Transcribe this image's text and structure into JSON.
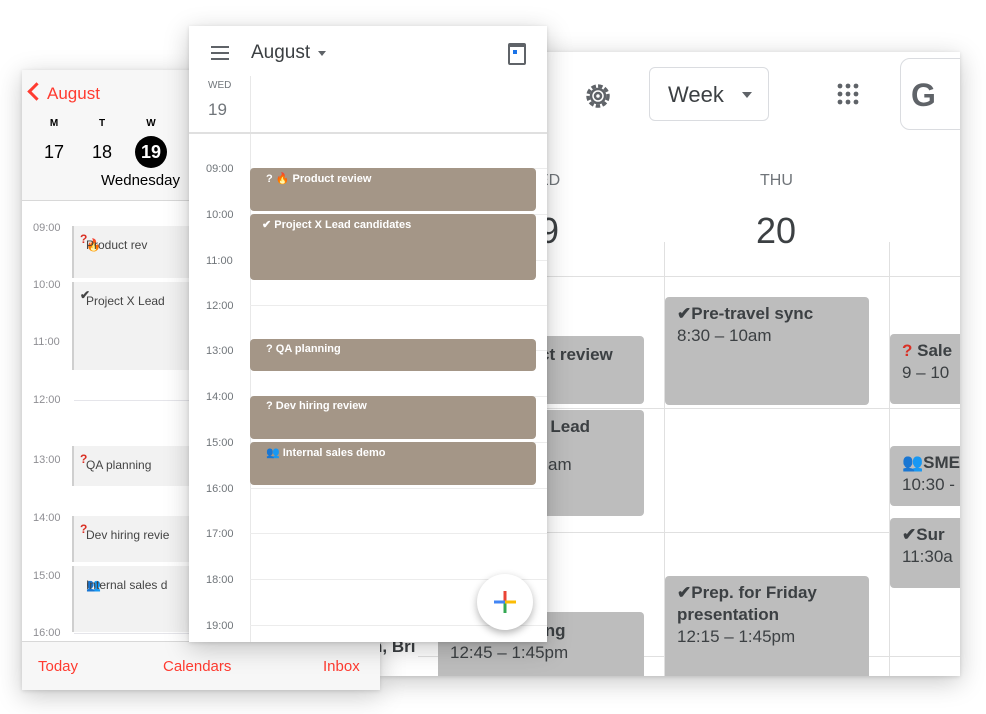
{
  "desktop": {
    "view_label": "Week",
    "search_partial": "G",
    "days": [
      {
        "name": "ED",
        "num": "9"
      },
      {
        "name": "THU",
        "num": "20"
      }
    ],
    "events": [
      {
        "title": "ct review",
        "time": ""
      },
      {
        "title": "( Lead",
        "time": "am"
      },
      {
        "title": "ing",
        "time": "12:45 – 1:45pm"
      },
      {
        "title": "n, Bri",
        "time": ""
      },
      {
        "title": "✔Pre-travel sync",
        "time": "8:30 – 10am"
      },
      {
        "title": "✔Prep. for Friday presentation",
        "time": "12:15 – 1:45pm"
      },
      {
        "title": "Sale",
        "time": "9 – 10"
      },
      {
        "title": "SME",
        "time": "10:30 -"
      },
      {
        "title": "✔Sur",
        "time": "11:30a"
      }
    ]
  },
  "ios": {
    "back_label": "August",
    "weekdays": [
      "M",
      "T",
      "W"
    ],
    "dates": [
      "17",
      "18",
      "19"
    ],
    "selected_date": "19",
    "day_title": "Wednesday",
    "times": [
      "09:00",
      "10:00",
      "11:00",
      "12:00",
      "13:00",
      "14:00",
      "15:00",
      "16:00"
    ],
    "events": [
      {
        "icon": "?",
        "icon2": "🔥",
        "title": "Product rev"
      },
      {
        "icon": "✔",
        "title": "Project X Lead"
      },
      {
        "icon": "?",
        "title": "QA planning"
      },
      {
        "icon": "?",
        "title": "Dev hiring revie"
      },
      {
        "icon": "👥",
        "title": "Internal sales d"
      }
    ],
    "tabbar": {
      "today": "Today",
      "calendars": "Calendars",
      "inbox": "Inbox"
    }
  },
  "android": {
    "month": "August",
    "weekday": "WED",
    "day": "19",
    "times": [
      "09:00",
      "10:00",
      "11:00",
      "12:00",
      "13:00",
      "14:00",
      "15:00",
      "16:00",
      "17:00",
      "18:00",
      "19:00"
    ],
    "events": [
      {
        "title": "? 🔥  Product review"
      },
      {
        "title": "✔ Project X Lead candidates"
      },
      {
        "title": "?  QA planning"
      },
      {
        "title": "? Dev hiring review"
      },
      {
        "title": "👥  Internal sales demo"
      }
    ]
  },
  "colors": {
    "ios_accent": "#ff3b30",
    "android_event": "#a49687",
    "desktop_event": "#bdbdbd"
  }
}
